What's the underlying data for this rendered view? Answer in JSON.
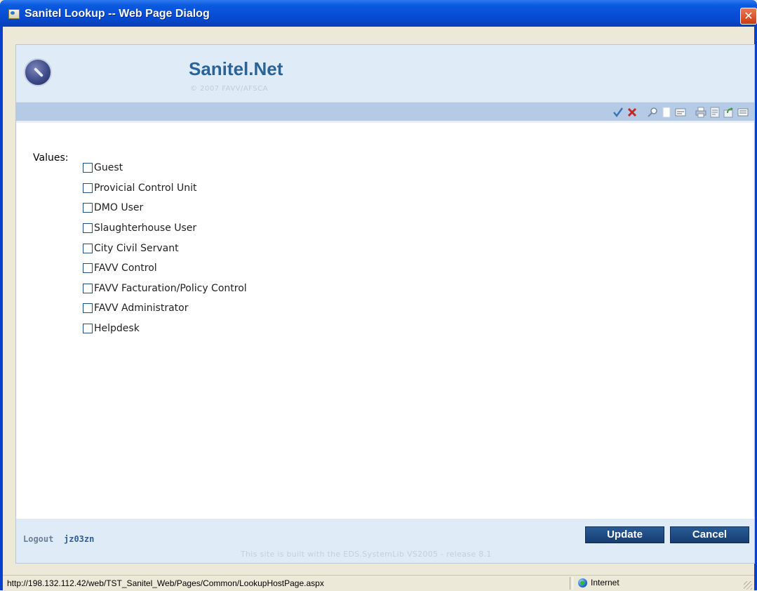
{
  "window": {
    "title": "Sanitel Lookup -- Web Page Dialog",
    "close_glyph": "✕"
  },
  "header": {
    "brand_title": "Sanitel.Net",
    "brand_subtitle": "© 2007 FAVV/AFSCA"
  },
  "toolbar": {
    "icons": [
      "checkmark-icon",
      "delete-icon",
      "search-icon",
      "new-document-icon",
      "form-icon",
      "print-icon",
      "save-icon",
      "export-icon",
      "list-icon"
    ],
    "accent_colors": {
      "check": "#3a73b8",
      "delete": "#c0282a"
    }
  },
  "lookup": {
    "values_label": "Values:",
    "options": [
      {
        "label": "Guest",
        "checked": false
      },
      {
        "label": "Provicial Control Unit",
        "checked": false
      },
      {
        "label": "DMO User",
        "checked": false
      },
      {
        "label": "Slaughterhouse User",
        "checked": false
      },
      {
        "label": "City Civil Servant",
        "checked": false
      },
      {
        "label": "FAVV Control",
        "checked": false
      },
      {
        "label": "FAVV Facturation/Policy Control",
        "checked": false
      },
      {
        "label": "FAVV Administrator",
        "checked": false
      },
      {
        "label": "Helpdesk",
        "checked": false
      }
    ]
  },
  "footer": {
    "logout_label": "Logout",
    "username": "jz03zn",
    "update_label": "Update",
    "cancel_label": "Cancel",
    "built_note": "This site is built with the EDS.SystemLib VS2005 - release 8.1"
  },
  "statusbar": {
    "url": "http://198.132.112.42/web/TST_Sanitel_Web/Pages/Common/LookupHostPage.aspx",
    "zone": "Internet"
  },
  "colors": {
    "header_bg": "#e0ebf8",
    "toolbar_bg": "#b5cbe5",
    "brand": "#2a6496",
    "button_bg": "#1f4a80",
    "titlebar": "#0a5ae0"
  }
}
